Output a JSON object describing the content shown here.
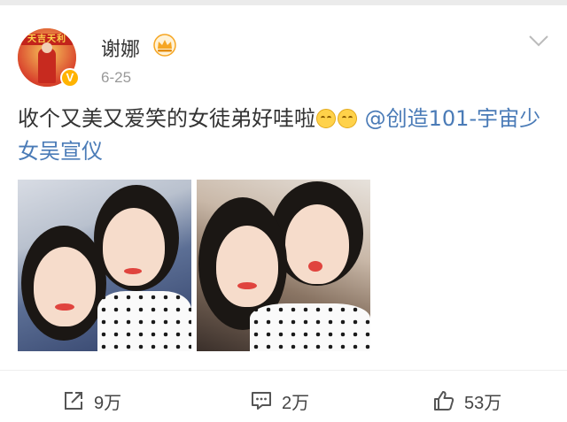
{
  "user": {
    "name": "谢娜",
    "date": "6-25",
    "avatar_banner": "天吉天利",
    "verified_mark": "V"
  },
  "post": {
    "text": "收个又美又爱笑的女徒弟好哇啦",
    "emoji_icons": [
      "smile-emoji-icon",
      "smile-emoji-icon"
    ],
    "mention": "@创造101-宇宙少女吴宣仪"
  },
  "actions": {
    "share_count": "9万",
    "comment_count": "2万",
    "like_count": "53万"
  },
  "colors": {
    "link": "#4a7bb7",
    "vip_crown": "#f6a623",
    "verified": "#ffb300"
  }
}
